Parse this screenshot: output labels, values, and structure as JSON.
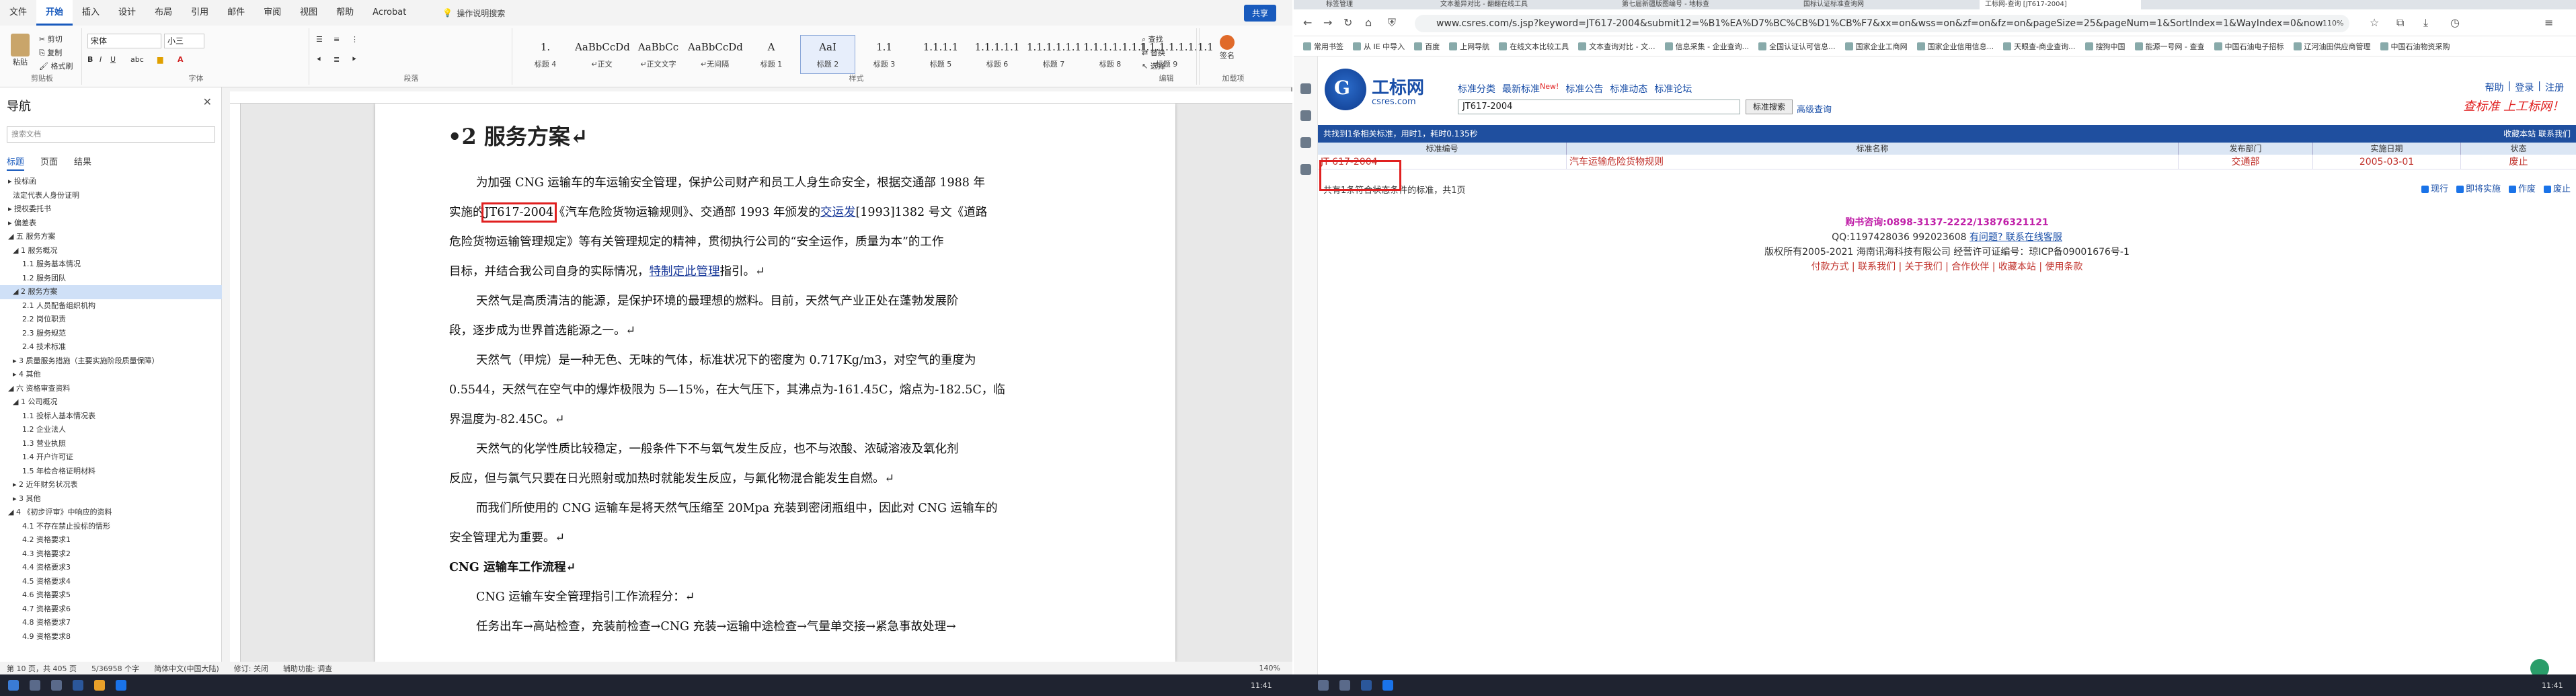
{
  "word": {
    "menu_tabs": [
      "文件",
      "开始",
      "插入",
      "设计",
      "布局",
      "引用",
      "邮件",
      "审阅",
      "视图",
      "帮助",
      "Acrobat"
    ],
    "active_tab": "开始",
    "search_hint": "操作说明搜索",
    "share": "共享",
    "ribbon": {
      "clipboard": {
        "paste": "粘贴",
        "cut": "剪切",
        "copy": "复制",
        "format_painter": "格式刷",
        "label": "剪贴板"
      },
      "font": {
        "family": "宋体",
        "size": "小三",
        "label": "字体"
      },
      "paragraph": {
        "label": "段落"
      },
      "styles": {
        "label": "样式",
        "tiles": [
          {
            "sample": "1.",
            "name": "标题 4"
          },
          {
            "sample": "AaBbCcDd",
            "name": "↵正文"
          },
          {
            "sample": "AaBbCc",
            "name": "↵正文文字"
          },
          {
            "sample": "AaBbCcDd",
            "name": "↵无间隔"
          },
          {
            "sample": "A",
            "name": "标题 1"
          },
          {
            "sample": "AaI",
            "name": "标题 2"
          },
          {
            "sample": "1.1",
            "name": "标题 3"
          },
          {
            "sample": "1.1.1.1",
            "name": "标题 5"
          },
          {
            "sample": "1.1.1.1.1",
            "name": "标题 6"
          },
          {
            "sample": "1.1.1.1.1.1",
            "name": "标题 7"
          },
          {
            "sample": "1.1.1.1.1.1.1",
            "name": "标题 8"
          },
          {
            "sample": "1.1.1.1.1.1.1.1",
            "name": "标题 9"
          }
        ]
      },
      "editing": {
        "find": "查找",
        "replace": "替换",
        "select": "选择",
        "label": "编辑"
      },
      "acrobat": {
        "sign": "签名",
        "label": "加载项"
      }
    },
    "nav": {
      "title": "导航",
      "search_placeholder": "搜索文档",
      "tabs": [
        "标题",
        "页面",
        "结果"
      ],
      "items": [
        "▸ 投标函",
        "  法定代表人身份证明",
        "▸ 授权委托书",
        "▸ 偏差表",
        "◢ 五 服务方案",
        "  ◢ 1 服务概况",
        "      1.1 服务基本情况",
        "      1.2 服务团队",
        "  ◢ 2 服务方案",
        "      2.1 人员配备组织机构",
        "      2.2 岗位职责",
        "      2.3 服务规范",
        "      2.4 技术标准",
        "  ▸ 3 质量服务措施（主要实施阶段质量保障）",
        "  ▸ 4 其他",
        "◢ 六 资格审查资料",
        "  ◢ 1 公司概况",
        "      1.1 投标人基本情况表",
        "      1.2 企业法人",
        "      1.3 营业执照",
        "      1.4 开户许可证",
        "      1.5 年检合格证明材料",
        "  ▸ 2 近年财务状况表",
        "  ▸ 3 其他",
        "◢ 4 《初步评审》中响应的资料",
        "      4.1 不存在禁止投标的情形",
        "      4.2 资格要求1",
        "      4.3 资格要求2",
        "      4.4 资格要求3",
        "      4.5 资格要求4",
        "      4.6 资格要求5",
        "      4.7 资格要求6",
        "      4.8 资格要求7",
        "      4.9 资格要求8"
      ],
      "selected_index": 8
    },
    "doc": {
      "heading": "•2   服务方案↵",
      "p1_a": "为加强 CNG 运输车的车运输安全管理，保护公司财产和员工人身生命安全，根据交通部 1988 年",
      "p1_b_pre": "实施的",
      "p1_b_code": "JT617-2004",
      "p1_b_post": "《汽车危险货物运输规则》、交通部 1993 年颁发的",
      "p1_b_link": "交运发",
      "p1_b_tail": "[1993]1382 号文《道路",
      "p1_c": "危险货物运输管理规定》等有关管理规定的精神，贯彻执行公司的“安全运作，质量为本”的工作",
      "p1_d_pre": "目标，并结合我公司自身的实际情况，",
      "p1_d_link": "特制定此管理",
      "p1_d_post": "指引。↵",
      "p2_a": "天然气是高质清洁的能源，是保护环境的最理想的燃料。目前，天然气产业正处在蓬勃发展阶",
      "p2_b": "段，逐步成为世界首选能源之一。↵",
      "p3_a": "天然气（甲烷）是一种无色、无味的气体，标准状况下的密度为 0.717Kg/m3，对空气的重度为",
      "p3_b": "0.5544，天然气在空气中的爆炸极限为 5—15%，在大气压下，其沸点为-161.45C，熔点为-182.5C，临",
      "p3_c": "界温度为-82.45C。↵",
      "p4_a": "天然气的化学性质比较稳定，一般条件下不与氧气发生反应，也不与浓酸、浓碱溶液及氧化剂",
      "p4_b": "反应，但与氯气只要在日光照射或加热时就能发生反应，与氟化物混合能发生自燃。↵",
      "p5_a": "而我们所使用的 CNG 运输车是将天然气压缩至 20Mpa 充装到密闭瓶组中，因此对 CNG 运输车的",
      "p5_b": "安全管理尤为重要。↵",
      "sub_heading": "CNG 运输车工作流程↵",
      "p6": "CNG 运输车安全管理指引工作流程分：↵",
      "p7": "任务出车→高站检查，充装前检查→CNG 充装→运输中途检查→气量单交接→紧急事故处理→"
    },
    "status": {
      "page": "第 10 页，共 405 页",
      "words": "5/36958 个字",
      "lang": "简体中文(中国大陆)",
      "revision": "修订: 关闭",
      "accessibility": "辅助功能: 调查",
      "zoom": "140%"
    }
  },
  "browser": {
    "tabs": [
      "标签管理",
      "文本差异对比 - 翻翻在线工具",
      "第七届新疆版图编号 - 地标查",
      "国标认证标准查询网",
      "工标网-查询 [JT617-2004]"
    ],
    "active_tab_index": 4,
    "url": "www.csres.com/s.jsp?keyword=JT617-2004&submit12=%B1%EA%D7%BC%CB%D1%CB%F7&xx=on&wss=on&zf=on&fz=on&pageSize=25&pageNum=1&SortIndex=1&WayIndex=0&now",
    "zoom": "110%",
    "bookmarks": [
      "常用书签",
      "从 IE 中导入",
      "百度",
      "上网导航",
      "在线文本比较工具",
      "文本查询对比 - 文...",
      "信息采集 - 企业查询...",
      "全国认证认可信息...",
      "国家企业工商网",
      "国家企业信用信息...",
      "天眼查-商业查询...",
      "搜狗中国",
      "能源一号网 - 查查",
      "中国石油电子招标",
      "辽河油田供应商管理",
      "中国石油物资采购"
    ],
    "site": {
      "logo_letter": "G",
      "name": "工标网",
      "domain": "csres.com",
      "nav": [
        "标准分类",
        "最新标准",
        "标准公告",
        "标准动态",
        "标准论坛"
      ],
      "nav_new": "New!",
      "search_value": "JT617-2004",
      "search_button": "标准搜索",
      "advanced": "高级查询",
      "top_links": [
        "帮助",
        "登录",
        "注册"
      ],
      "slogan": "查标准 上工标网！",
      "result_bar": "共找到1条相关标准，用时1，耗时0.135秒",
      "result_bar_right": "收藏本站  联系我们",
      "columns": [
        "标准编号",
        "标准名称",
        "发布部门",
        "实施日期",
        "状态"
      ],
      "row": {
        "code": "JT 617-2004",
        "name": "汽车运输危险货物规则",
        "dept": "交通部",
        "date": "2005-03-01",
        "status": "废止"
      },
      "summary": "共有1条符合状态条件的标准，共1页",
      "filters": [
        "现行",
        "即将实施",
        "作废",
        "废止"
      ],
      "footer": {
        "phone": "购书咨询:0898-3137-2222/13876321121",
        "qq_pre": "QQ:1197428036  992023608 ",
        "qq_link": "有问题?  联系在线客服",
        "copyright": "版权所有2005-2021 海南讯海科技有限公司 经营许可证编号：琼ICP备09001676号-1",
        "links": "付款方式 | 联系我们 | 关于我们 | 合作伙伴 | 收藏本站 | 使用条款"
      }
    }
  },
  "taskbar": {
    "clock_left": "11:41",
    "clock_right": "11:41"
  }
}
